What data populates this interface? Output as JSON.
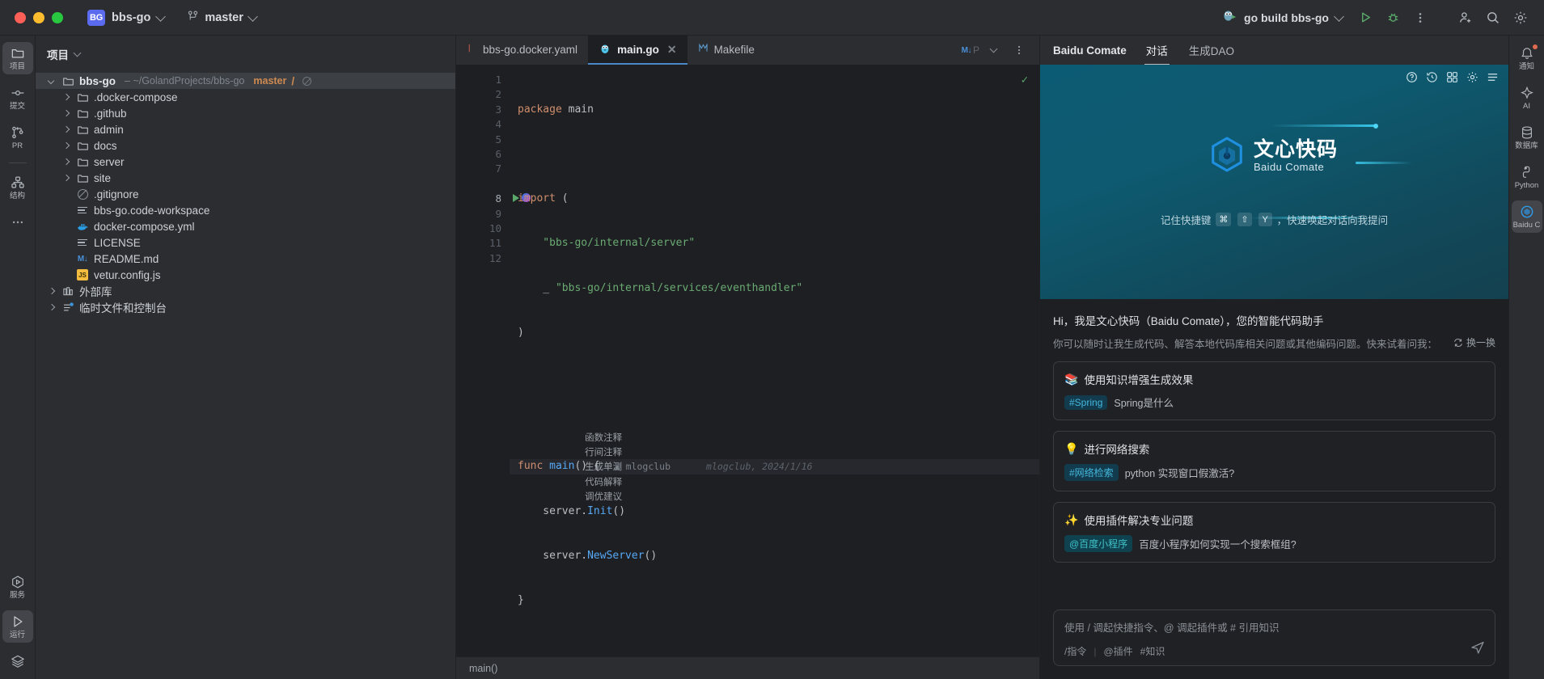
{
  "titlebar": {
    "project_badge": "BG",
    "project_name": "bbs-go",
    "branch": "master",
    "run_config": "go build bbs-go",
    "icons": {
      "run": "run-icon",
      "debug": "debug-icon",
      "more": "more-vertical-icon",
      "add_user": "add-user-icon",
      "search": "search-icon",
      "settings": "gear-icon"
    }
  },
  "left_rail": {
    "items": [
      {
        "label": "项目",
        "icon": "folder-icon",
        "active": true
      },
      {
        "label": "提交",
        "icon": "commit-icon",
        "active": false
      },
      {
        "label": "PR",
        "icon": "pull-request-icon",
        "active": false
      },
      {
        "label": "结构",
        "icon": "structure-icon",
        "active": false
      },
      {
        "label": "",
        "icon": "more-horizontal-icon",
        "active": false
      }
    ],
    "bottom_items": [
      {
        "label": "服务",
        "icon": "services-icon",
        "active": false
      },
      {
        "label": "运行",
        "icon": "run-play-icon",
        "active": true
      },
      {
        "label": "",
        "icon": "layers-icon",
        "active": false
      }
    ]
  },
  "project_panel": {
    "title": "项目",
    "root": {
      "name": "bbs-go",
      "path": "~/GolandProjects/bbs-go",
      "branch": "master",
      "separator": "/"
    },
    "tree": [
      {
        "name": ".docker-compose",
        "type": "folder",
        "indent": 1,
        "icon": "folder-icon"
      },
      {
        "name": ".github",
        "type": "folder",
        "indent": 1,
        "icon": "folder-icon"
      },
      {
        "name": "admin",
        "type": "folder",
        "indent": 1,
        "icon": "folder-icon"
      },
      {
        "name": "docs",
        "type": "folder",
        "indent": 1,
        "icon": "folder-icon"
      },
      {
        "name": "server",
        "type": "folder",
        "indent": 1,
        "icon": "folder-icon"
      },
      {
        "name": "site",
        "type": "folder",
        "indent": 1,
        "icon": "folder-icon"
      },
      {
        "name": ".gitignore",
        "type": "file",
        "indent": 1,
        "icon": "gitignore-icon"
      },
      {
        "name": "bbs-go.code-workspace",
        "type": "file",
        "indent": 1,
        "icon": "text-file-icon"
      },
      {
        "name": "docker-compose.yml",
        "type": "file",
        "indent": 1,
        "icon": "docker-icon"
      },
      {
        "name": "LICENSE",
        "type": "file",
        "indent": 1,
        "icon": "text-file-icon"
      },
      {
        "name": "README.md",
        "type": "file",
        "indent": 1,
        "icon": "markdown-icon"
      },
      {
        "name": "vetur.config.js",
        "type": "file",
        "indent": 1,
        "icon": "javascript-icon"
      },
      {
        "name": "外部库",
        "type": "library",
        "indent": 0,
        "icon": "library-icon"
      },
      {
        "name": "临时文件和控制台",
        "type": "scratch",
        "indent": 0,
        "icon": "scratch-icon"
      }
    ]
  },
  "editor": {
    "tabs": [
      {
        "label": "bbs-go.docker.yaml",
        "icon": "yaml-icon",
        "active": false,
        "closable": false
      },
      {
        "label": "main.go",
        "icon": "go-gopher-icon",
        "active": true,
        "closable": true
      },
      {
        "label": "Makefile",
        "icon": "makefile-icon",
        "active": false,
        "closable": false
      }
    ],
    "tab_extra": {
      "markdown": "M↓",
      "preview": "P",
      "chevron": "chevron-down-icon",
      "more": "more-vertical-icon"
    },
    "inlay_hints": [
      "函数注释",
      "行间注释",
      "生成单测",
      "代码解释",
      "调优建议"
    ],
    "annotation": {
      "author": "mlogclub",
      "vcs": "mlogclub, 2024/1/16"
    },
    "lines": [
      {
        "n": 1,
        "segments": [
          {
            "t": "kw",
            "v": "package"
          },
          {
            "t": "pun",
            "v": " main"
          }
        ]
      },
      {
        "n": 2,
        "segments": []
      },
      {
        "n": 3,
        "segments": [
          {
            "t": "kw",
            "v": "import"
          },
          {
            "t": "pun",
            "v": " ("
          }
        ]
      },
      {
        "n": 4,
        "segments": [
          {
            "t": "str",
            "v": "    \"bbs-go/internal/server\""
          }
        ]
      },
      {
        "n": 5,
        "segments": [
          {
            "t": "pun",
            "v": "    _ "
          },
          {
            "t": "str",
            "v": "\"bbs-go/internal/services/eventhandler\""
          }
        ]
      },
      {
        "n": 6,
        "segments": [
          {
            "t": "pun",
            "v": ")"
          }
        ]
      },
      {
        "n": 7,
        "segments": []
      },
      {
        "n": 8,
        "segments": [
          {
            "t": "kw",
            "v": "func "
          },
          {
            "t": "fn",
            "v": "main"
          },
          {
            "t": "pun",
            "v": "() {"
          }
        ],
        "current": true,
        "runnable": true
      },
      {
        "n": 9,
        "segments": [
          {
            "t": "pun",
            "v": "    server."
          },
          {
            "t": "fn",
            "v": "Init"
          },
          {
            "t": "pun",
            "v": "()"
          }
        ]
      },
      {
        "n": 10,
        "segments": [
          {
            "t": "pun",
            "v": "    server."
          },
          {
            "t": "fn",
            "v": "NewServer"
          },
          {
            "t": "pun",
            "v": "()"
          }
        ]
      },
      {
        "n": 11,
        "segments": [
          {
            "t": "pun",
            "v": "}"
          }
        ]
      },
      {
        "n": 12,
        "segments": []
      }
    ],
    "status_bar": "main()"
  },
  "comate": {
    "title": "Baidu Comate",
    "tabs": [
      {
        "label": "对话",
        "active": true
      },
      {
        "label": "生成DAO",
        "active": false
      }
    ],
    "header_icons": [
      "help-icon",
      "history-icon",
      "new-chat-icon",
      "gear-icon",
      "menu-icon"
    ],
    "banner": {
      "logo_main": "文心快码",
      "logo_sub": "Baidu Comate",
      "hint_prefix": "记住快捷键",
      "keys": [
        "⌘",
        "⇧",
        "Y"
      ],
      "hint_suffix": "，快速唤起对话向我提问"
    },
    "greeting": "Hi，我是文心快码（Baidu Comate），您的智能代码助手",
    "greeting_sub": "你可以随时让我生成代码、解答本地代码库相关问题或其他编码问题。快来试着问我：",
    "swap_label": "换一换",
    "cards": [
      {
        "emoji": "📚",
        "title": "使用知识增强生成效果",
        "tag": "#Spring",
        "tag_style": "green",
        "text": "Spring是什么"
      },
      {
        "emoji": "💡",
        "title": "进行网络搜索",
        "tag": "#网络检索",
        "tag_style": "green",
        "text": "python 实现窗口假激活?"
      },
      {
        "emoji": "✨",
        "title": "使用插件解决专业问题",
        "tag": "@百度小程序",
        "tag_style": "teal",
        "text": "百度小程序如何实现一个搜索框组?"
      }
    ],
    "composer": {
      "placeholder": "使用 / 调起快捷指令、@ 调起插件或 # 引用知识",
      "shortcuts": [
        "/指令",
        "@插件",
        "#知识"
      ],
      "send_icon": "send-icon"
    }
  },
  "right_rail": {
    "items": [
      {
        "label": "通知",
        "icon": "notifications-icon",
        "active": false,
        "badge": true
      },
      {
        "label": "AI",
        "icon": "ai-icon",
        "active": false,
        "badge": false
      },
      {
        "label": "数据库",
        "icon": "database-icon",
        "active": false,
        "badge": false
      },
      {
        "label": "Python",
        "icon": "python-icon",
        "active": false,
        "badge": false
      },
      {
        "label": "Baidu C",
        "icon": "comate-icon",
        "active": true,
        "badge": false
      }
    ]
  }
}
